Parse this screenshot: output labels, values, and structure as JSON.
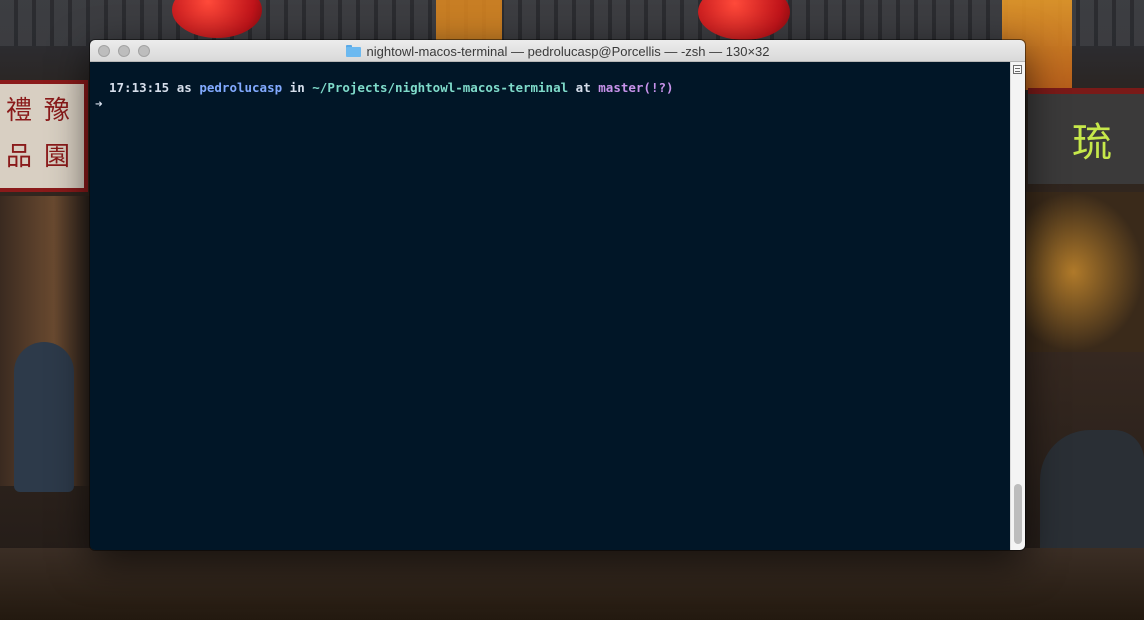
{
  "window": {
    "title": "nightowl-macos-terminal — pedrolucasp@Porcellis — -zsh — 130×32",
    "title_icon": "folder-icon"
  },
  "wallpaper": {
    "sign_left_chars": [
      "禮",
      "豫",
      "品",
      "園"
    ],
    "sign_right_glyph": "琉"
  },
  "terminal": {
    "prompt": {
      "time": "17:13:15",
      "as_word": "as",
      "user": "pedrolucasp",
      "in_word": "in",
      "path": "~/Projects/nightowl-macos-terminal",
      "at_word": "at",
      "branch": "master(!?)"
    },
    "cursor_line": "➜"
  },
  "colors": {
    "background": "#011627",
    "foreground": "#d6deeb",
    "user": "#82aaff",
    "path": "#7fdbca",
    "branch": "#c792ea"
  }
}
